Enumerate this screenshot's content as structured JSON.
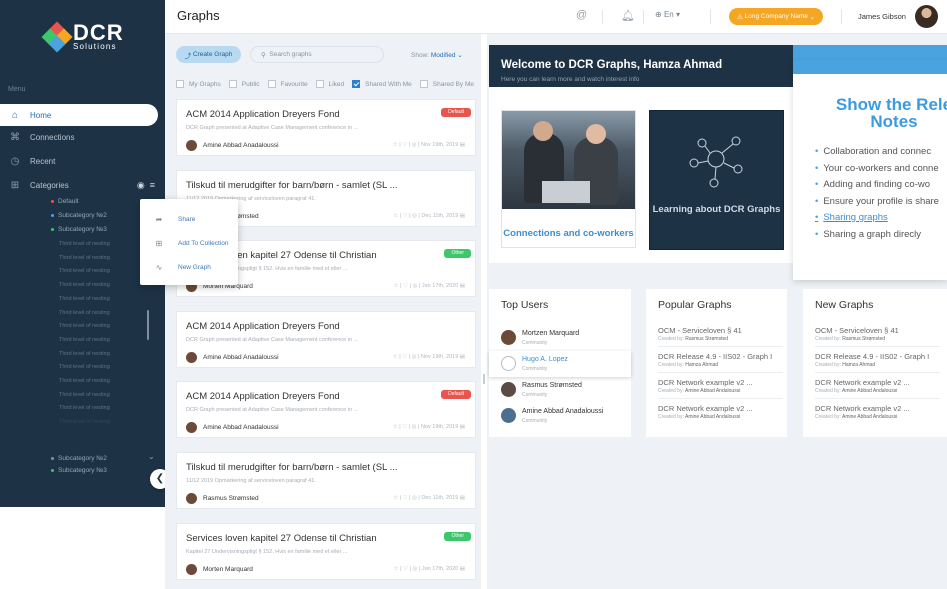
{
  "sidebar": {
    "logo": {
      "brand": "DCR",
      "tagline": "Solutions"
    },
    "menu_label": "Menu",
    "items": [
      {
        "label": "Home",
        "icon": "home-icon"
      },
      {
        "label": "Connections",
        "icon": "connections-icon"
      },
      {
        "label": "Recent",
        "icon": "clock-icon"
      },
      {
        "label": "Categories",
        "icon": "grid-icon"
      }
    ],
    "subcategories": [
      "Default",
      "Subcategory №2",
      "Subcategory №3"
    ],
    "third_levels": [
      "Third level of nesting",
      "Third level of nesting",
      "Third level of nesting",
      "Third level of nesting",
      "Third level of nesting",
      "Third level of nesting",
      "Third level of nesting",
      "Third level of nesting",
      "Third level of nesting",
      "Third level of nesting",
      "Third level of nesting",
      "Third level of nesting",
      "Third level of nesting",
      "Third level of nesting"
    ],
    "bottom_subcategories": [
      "Subcategory №2",
      "Subcategory №3"
    ]
  },
  "topbar": {
    "title": "Graphs",
    "language": "En",
    "company": "Long Company Name",
    "user_name": "James Gibson"
  },
  "graphs": {
    "create_label": "Create Graph",
    "search_placeholder": "Search graphs",
    "show_label": "Show:",
    "show_value": "Modified",
    "filters": [
      {
        "label": "My Graphs",
        "checked": false
      },
      {
        "label": "Public",
        "checked": false
      },
      {
        "label": "Favourite",
        "checked": false
      },
      {
        "label": "Liked",
        "checked": false
      },
      {
        "label": "Shared With Me",
        "checked": true
      },
      {
        "label": "Shared By Me",
        "checked": false
      }
    ],
    "cards": [
      {
        "title": "ACM 2014 Application Dreyers Fond",
        "desc": "DCR Graph presented at Adaptive Case Management conference in ...",
        "author": "Amine Abbad Anadaloussi",
        "date": "Nov 19th, 2019",
        "badge": "Default"
      },
      {
        "title": "Tilskud til merudgifter for barn/børn - samlet (SL ...",
        "desc": "11/12 2019 Opmarkering af serviceloven paragraf 41.",
        "author": "Rasmus Strømsted",
        "date": "Dec 11th, 2019",
        "badge": ""
      },
      {
        "title": "Services loven kapitel 27 Odense til Christian",
        "desc": "Kapitel 27 Undervisningspligt § 152. Hvis en familie med et eller ...",
        "author": "Morten Marquard",
        "date": "Jan 17th, 2020",
        "badge": "Other"
      },
      {
        "title": "ACM 2014 Application Dreyers Fond",
        "desc": "DCR Graph presented at Adaptive Case Management conference in ...",
        "author": "Amine Abbad Anadaloussi",
        "date": "Nov 19th, 2019",
        "badge": ""
      },
      {
        "title": "ACM 2014 Application Dreyers Fond",
        "desc": "DCR Graph presented at Adaptive Case Management conference in ...",
        "author": "Amine Abbad Anadaloussi",
        "date": "Nov 19th, 2019",
        "badge": "Default"
      },
      {
        "title": "Tilskud til merudgifter for barn/børn - samlet (SL ...",
        "desc": "11/12 2019 Opmarkering af serviceloven paragraf 41.",
        "author": "Rasmus Strømsted",
        "date": "Dec 11th, 2019",
        "badge": ""
      },
      {
        "title": "Services loven kapitel 27 Odense til Christian",
        "desc": "Kapitel 27 Undervisningspligt § 152. Hvis en familie med et eller ...",
        "author": "Morten Marquard",
        "date": "Jan 17th, 2020",
        "badge": "Other"
      }
    ]
  },
  "context_menu": [
    "Share",
    "Add To Collection",
    "New Graph"
  ],
  "welcome": {
    "title": "Welcome to DCR Graphs, Hamza Ahmad",
    "subtitle": "Here you can learn more and watch interest info",
    "tile1": "Connections and co-workers",
    "tile2": "Learning about DCR Graphs"
  },
  "promo": {
    "heading_line1": "Show the Rele",
    "heading_line2": "Notes",
    "items": [
      "Collaboration and connec",
      "Your co-workers and conne",
      "Adding and finding co-wo",
      "Ensure your profile is share",
      "Sharing graphs",
      "Sharing a graph direcly"
    ]
  },
  "top_users": {
    "title": "Top Users",
    "users": [
      {
        "name": "Mortzen Marquard",
        "role": "Community"
      },
      {
        "name": "Hugo A. Lopez",
        "role": "Community"
      },
      {
        "name": "Rasmus Strømsted",
        "role": "Community"
      },
      {
        "name": "Amine Abbad Anadaloussi",
        "role": "Community"
      }
    ]
  },
  "popular": {
    "title": "Popular Graphs",
    "created_by": "Created by:",
    "items": [
      {
        "name": "OCM - Serviceloven § 41",
        "author": "Rasmus Strømsted"
      },
      {
        "name": "DCR Release 4.9 - IIS02 - Graph I",
        "author": "Hamza Ahmad"
      },
      {
        "name": "DCR Network example v2 ...",
        "author": "Amine Abbad Andaloussi"
      },
      {
        "name": "DCR Network example v2 ...",
        "author": "Amine Abbad Andaloussi"
      }
    ]
  },
  "new_graphs": {
    "title": "New Graphs",
    "created_by": "Created by:",
    "items": [
      {
        "name": "OCM - Serviceloven § 41",
        "author": "Rasmus Strømsted"
      },
      {
        "name": "DCR Release 4.9 - IIS02 - Graph I",
        "author": "Hamza Ahmad"
      },
      {
        "name": "DCR Network example v2 ...",
        "author": "Amine Abbad Andaloussi"
      },
      {
        "name": "DCR Network example v2 ...",
        "author": "Amine Abbad Andaloussi"
      }
    ]
  },
  "colors": {
    "sidebar": "#1e3246",
    "accent": "#f5a623",
    "link": "#3b8ed3",
    "default_badge": "#e8554e",
    "other_badge": "#3cc76a"
  }
}
